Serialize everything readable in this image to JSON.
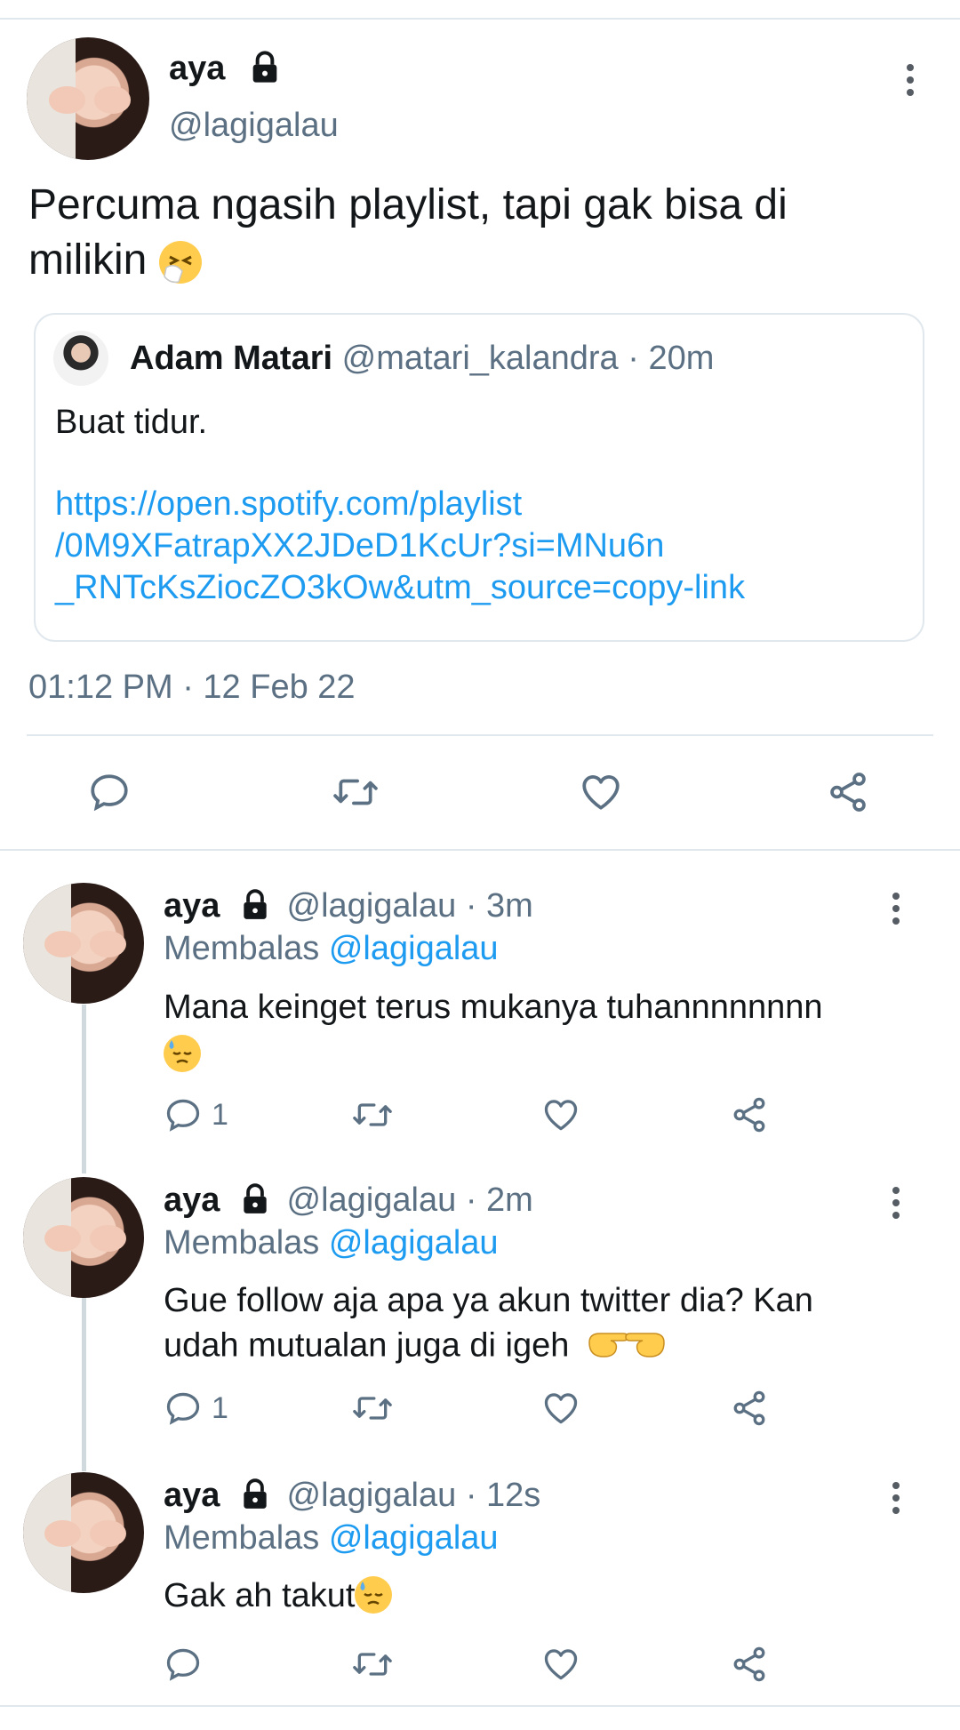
{
  "main_tweet": {
    "name": "aya",
    "handle": "@lagigalau",
    "text": "Percuma ngasih playlist, tapi gak bisa di milikin",
    "emoji": "sneezing-face",
    "timestamp": "01:12 PM · 12 Feb 22"
  },
  "quoted": {
    "name": "Adam Matari",
    "handle": "@matari_kalandra",
    "time": "· 20m",
    "text": "Buat tidur.",
    "link_line1": "https://open.spotify.com/playlist",
    "link_line2": "/0M9XFatrapXX2JDeD1KcUr?si=MNu6n",
    "link_line3": "_RNTcKsZiocZO3kOw&utm_source=copy-link"
  },
  "replies": [
    {
      "name": "aya",
      "handle": "@lagigalau",
      "time": "· 3m",
      "replying_prefix": "Membalas",
      "replying_to": "@lagigalau",
      "text_line1": "Mana keinget terus mukanya tuhannnnnnnn",
      "text_line2": "",
      "reply_count": "1"
    },
    {
      "name": "aya",
      "handle": "@lagigalau",
      "time": "· 2m",
      "replying_prefix": "Membalas",
      "replying_to": "@lagigalau",
      "text_line1": "Gue follow aja apa ya akun twitter dia? Kan",
      "text_line2": "udah mutualan juga di igeh",
      "reply_count": "1"
    },
    {
      "name": "aya",
      "handle": "@lagigalau",
      "time": "· 12s",
      "replying_prefix": "Membalas",
      "replying_to": "@lagigalau",
      "text_line1": "Gak ah takut",
      "text_line2": "",
      "reply_count": ""
    }
  ],
  "icons": {
    "reply": "reply-icon",
    "retweet": "retweet-icon",
    "like": "heart-icon",
    "share": "share-icon",
    "lock": "lock-icon",
    "more": "more-vertical-icon"
  },
  "colors": {
    "link": "#1d9bf0",
    "secondary_text": "#5b7083",
    "divider": "#e1e8ed"
  }
}
